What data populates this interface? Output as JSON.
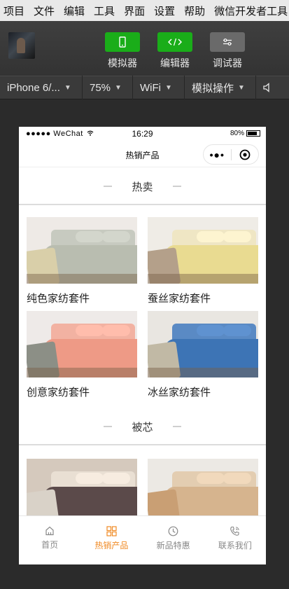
{
  "menu": [
    "项目",
    "文件",
    "编辑",
    "工具",
    "界面",
    "设置",
    "帮助",
    "微信开发者工具"
  ],
  "toolbar": {
    "simulator_label": "模拟器",
    "editor_label": "编辑器",
    "debugger_label": "调试器"
  },
  "devicebar": {
    "device": "iPhone 6/...",
    "zoom": "75%",
    "network": "WiFi",
    "operation": "模拟操作"
  },
  "phone": {
    "carrier": "●●●●● WeChat",
    "time": "16:29",
    "battery": "80%",
    "battery_level": 0.8,
    "nav_title": "热销产品"
  },
  "sections": [
    {
      "title": "热卖",
      "products": [
        {
          "name": "纯色家纺套件",
          "colors": {
            "duvet": "#b9bdb0",
            "throw": "#d9cfa9",
            "head": "#c7cac0",
            "wall": "#eeeae6"
          }
        },
        {
          "name": "蚕丝家纺套件",
          "colors": {
            "duvet": "#e9db91",
            "throw": "#b4a08a",
            "head": "#efe6c4",
            "wall": "#efece6"
          }
        },
        {
          "name": "创意家纺套件",
          "colors": {
            "duvet": "#ee9a86",
            "throw": "#8c8f86",
            "head": "#f2b2a2",
            "wall": "#eeeae8"
          }
        },
        {
          "name": "冰丝家纺套件",
          "colors": {
            "duvet": "#3d74b5",
            "throw": "#c1b9a5",
            "head": "#5a8ac4",
            "wall": "#e9e6e1"
          }
        }
      ]
    },
    {
      "title": "被芯",
      "products": [
        {
          "name": "",
          "colors": {
            "duvet": "#5b4a4a",
            "throw": "#d9d2c8",
            "head": "#e9dfd3",
            "wall": "#d5c9bd"
          }
        },
        {
          "name": "",
          "colors": {
            "duvet": "#d6b48e",
            "throw": "#c99f74",
            "head": "#e3cdb1",
            "wall": "#ece9e4"
          }
        }
      ]
    }
  ],
  "tabbar": [
    {
      "label": "首页",
      "icon": "home-icon",
      "active": false
    },
    {
      "label": "热销产品",
      "icon": "grid-icon",
      "active": true
    },
    {
      "label": "新品特惠",
      "icon": "clock-icon",
      "active": false
    },
    {
      "label": "联系我们",
      "icon": "phone-icon",
      "active": false
    }
  ],
  "accent": "#f08a24"
}
